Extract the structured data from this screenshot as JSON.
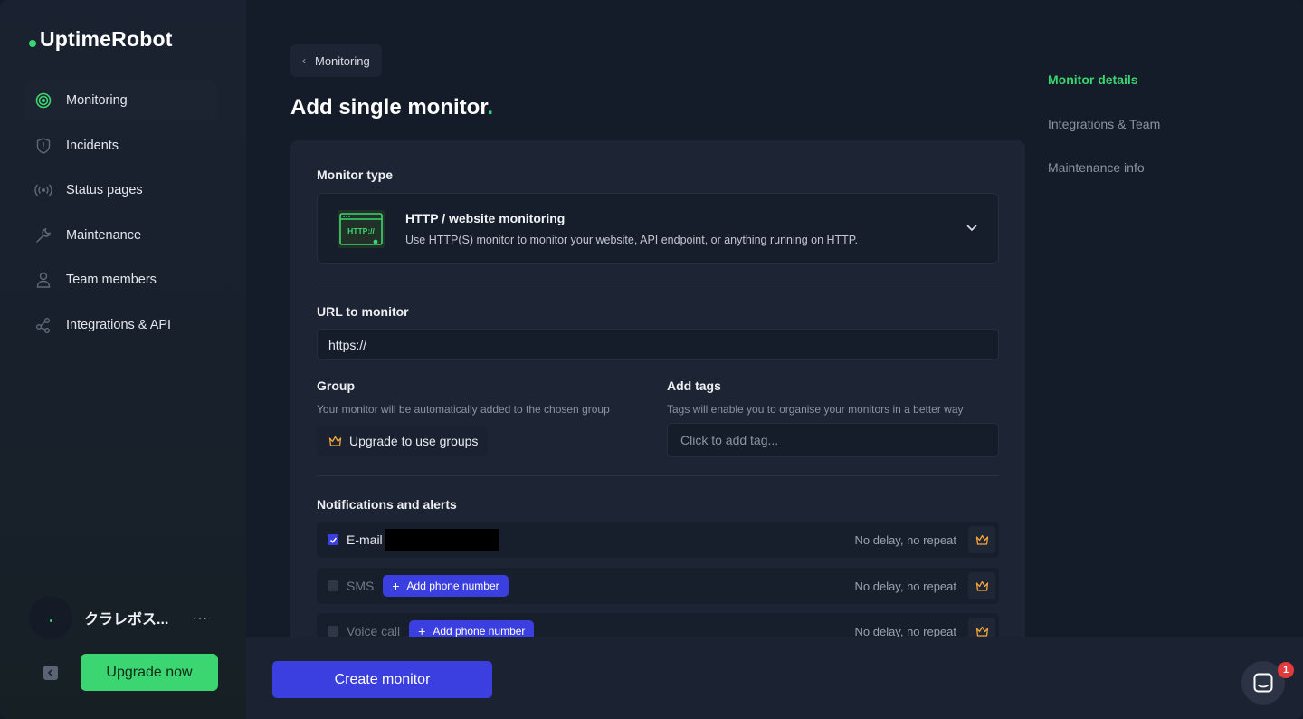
{
  "brand": {
    "name": "UptimeRobot",
    "accent": "#3bd671"
  },
  "sidebar": {
    "items": [
      {
        "label": "Monitoring",
        "icon": "monitoring-icon",
        "active": true
      },
      {
        "label": "Incidents",
        "icon": "shield-icon"
      },
      {
        "label": "Status pages",
        "icon": "broadcast-icon"
      },
      {
        "label": "Maintenance",
        "icon": "wrench-icon"
      },
      {
        "label": "Team members",
        "icon": "user-icon"
      },
      {
        "label": "Integrations & API",
        "icon": "share-icon"
      }
    ],
    "user_name": "クラレボス...",
    "more": "···",
    "upgrade_label": "Upgrade now"
  },
  "breadcrumb": {
    "label": "Monitoring"
  },
  "page": {
    "title": "Add single monitor",
    "title_accent": "."
  },
  "form": {
    "monitor_type_label": "Monitor type",
    "monitor_type": {
      "title": "HTTP / website monitoring",
      "description": "Use HTTP(S) monitor to monitor your website, API endpoint, or anything running on HTTP.",
      "icon_text": "HTTP://"
    },
    "url_label": "URL to monitor",
    "url_value": "https://",
    "group_label": "Group",
    "group_hint": "Your monitor will be automatically added to the chosen group",
    "group_button": "Upgrade to use groups",
    "tags_label": "Add tags",
    "tags_hint": "Tags will enable you to organise your monitors in a better way",
    "tags_placeholder": "Click to add tag...",
    "notifications_label": "Notifications and alerts",
    "notifications": [
      {
        "name": "E-mail",
        "checked": true,
        "delay": "No delay, no repeat"
      },
      {
        "name": "SMS",
        "checked": false,
        "action": "Add phone number",
        "delay": "No delay, no repeat"
      },
      {
        "name": "Voice call",
        "checked": false,
        "action": "Add phone number",
        "delay": "No delay, no repeat"
      }
    ]
  },
  "footer": {
    "create_label": "Create monitor"
  },
  "toc": {
    "items": [
      {
        "label": "Monitor details",
        "active": true
      },
      {
        "label": "Integrations & Team"
      },
      {
        "label": "Maintenance info"
      }
    ]
  },
  "chat": {
    "badge": "1"
  }
}
